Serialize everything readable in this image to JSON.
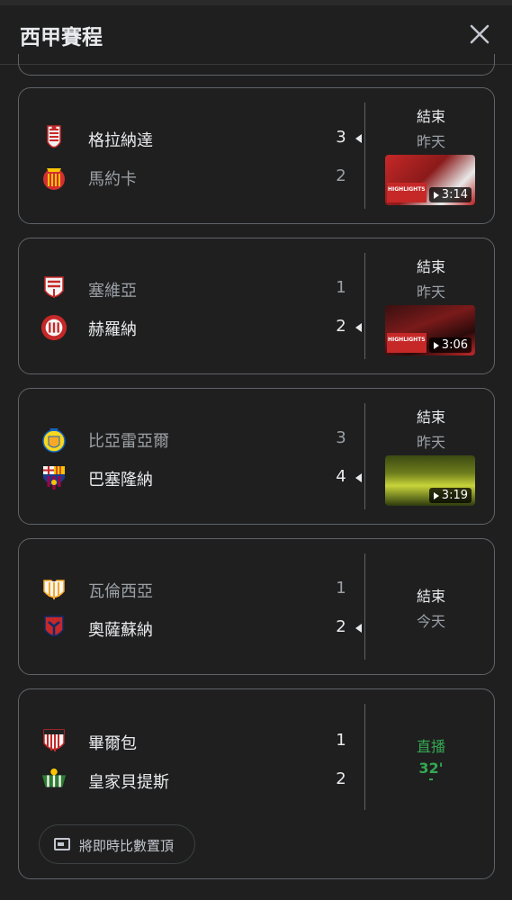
{
  "header": {
    "title": "西甲賽程"
  },
  "matches": [
    {
      "home": {
        "name": "格拉納達",
        "score": "3",
        "result": "win",
        "logo": "granada-crest"
      },
      "away": {
        "name": "馬約卡",
        "score": "2",
        "result": "lose",
        "logo": "mallorca-crest"
      },
      "status": "結束",
      "when": "昨天",
      "video": {
        "duration": "3:14",
        "label": "HIGHLIGHTS"
      }
    },
    {
      "home": {
        "name": "塞維亞",
        "score": "1",
        "result": "lose",
        "logo": "sevilla-crest"
      },
      "away": {
        "name": "赫羅納",
        "score": "2",
        "result": "win",
        "logo": "girona-crest"
      },
      "status": "結束",
      "when": "昨天",
      "video": {
        "duration": "3:06",
        "label": "HIGHLIGHTS"
      }
    },
    {
      "home": {
        "name": "比亞雷亞爾",
        "score": "3",
        "result": "lose",
        "logo": "villarreal-crest"
      },
      "away": {
        "name": "巴塞隆納",
        "score": "4",
        "result": "win",
        "logo": "barcelona-crest"
      },
      "status": "結束",
      "when": "昨天",
      "video": {
        "duration": "3:19"
      }
    },
    {
      "home": {
        "name": "瓦倫西亞",
        "score": "1",
        "result": "lose",
        "logo": "valencia-crest"
      },
      "away": {
        "name": "奧薩蘇納",
        "score": "2",
        "result": "win",
        "logo": "osasuna-crest"
      },
      "status": "結束",
      "when": "今天"
    },
    {
      "home": {
        "name": "畢爾包",
        "score": "1",
        "result": "win",
        "logo": "athletic-bilbao-crest"
      },
      "away": {
        "name": "皇家貝提斯",
        "score": "2",
        "result": "win",
        "logo": "real-betis-crest"
      },
      "status": "直播",
      "when": "32'",
      "live": true
    }
  ],
  "pin_button": {
    "label": "將即時比數置頂"
  },
  "colors": {
    "background": "#1f1f1f",
    "border": "#5f6368",
    "live": "#34a853",
    "text": "#e8eaed",
    "muted": "#9aa0a6"
  }
}
